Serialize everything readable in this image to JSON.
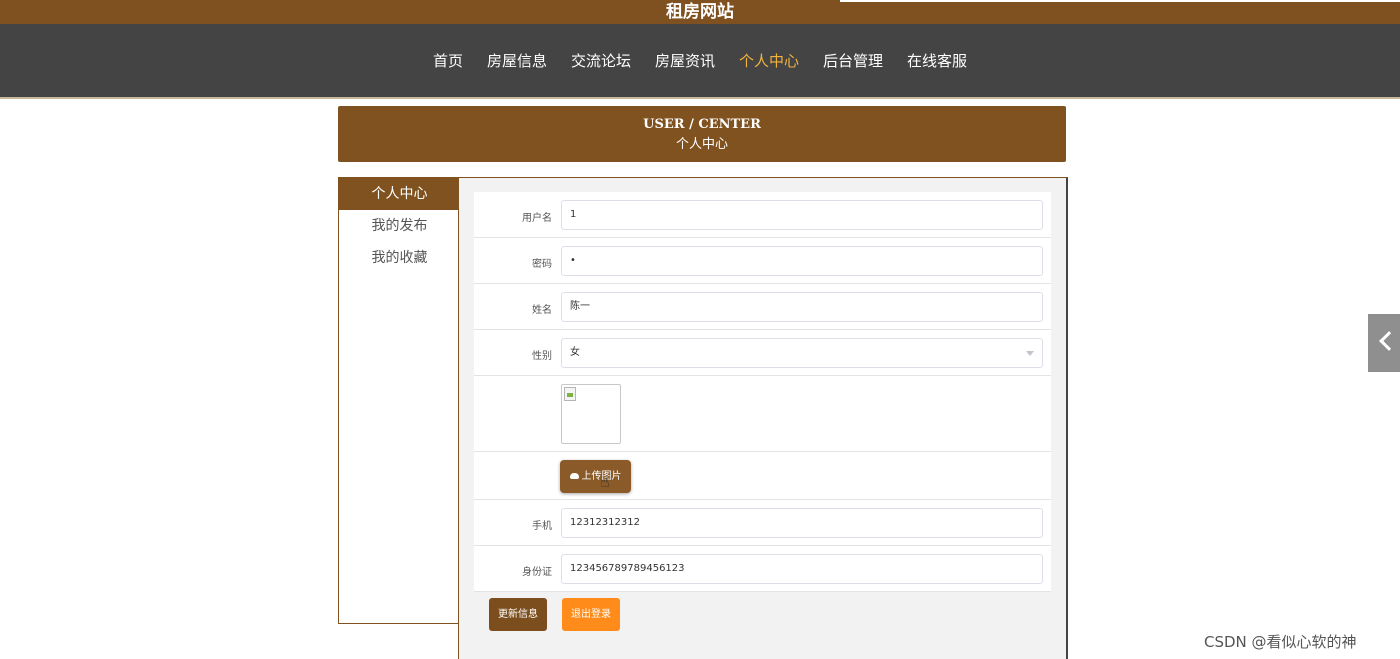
{
  "site": {
    "title": "租房网站"
  },
  "nav": {
    "items": [
      {
        "label": "首页"
      },
      {
        "label": "房屋信息"
      },
      {
        "label": "交流论坛"
      },
      {
        "label": "房屋资讯"
      },
      {
        "label": "个人中心"
      },
      {
        "label": "后台管理"
      },
      {
        "label": "在线客服"
      }
    ],
    "active_label": "个人中心",
    "active_color": "#f2b33d"
  },
  "banner": {
    "en": "USER / CENTER",
    "cn": "个人中心"
  },
  "sidebar": {
    "items": [
      {
        "label": "个人中心"
      },
      {
        "label": "我的发布"
      },
      {
        "label": "我的收藏"
      }
    ],
    "active_label": "个人中心"
  },
  "form": {
    "username": {
      "label": "用户名",
      "value": "1"
    },
    "password": {
      "label": "密码",
      "value": "•"
    },
    "name": {
      "label": "姓名",
      "value": "陈一"
    },
    "gender": {
      "label": "性别",
      "value": "女"
    },
    "upload_label": "上传图片",
    "phone": {
      "label": "手机",
      "value": "12312312312"
    },
    "id_card": {
      "label": "身份证",
      "value": "123456789789456123"
    }
  },
  "actions": {
    "update_label": "更新信息",
    "logout_label": "退出登录"
  },
  "watermark": "CSDN @看似心软的神",
  "colors": {
    "brand_brown": "#80521f",
    "nav_bg": "#444444",
    "logout_orange": "#ff8c1a"
  }
}
